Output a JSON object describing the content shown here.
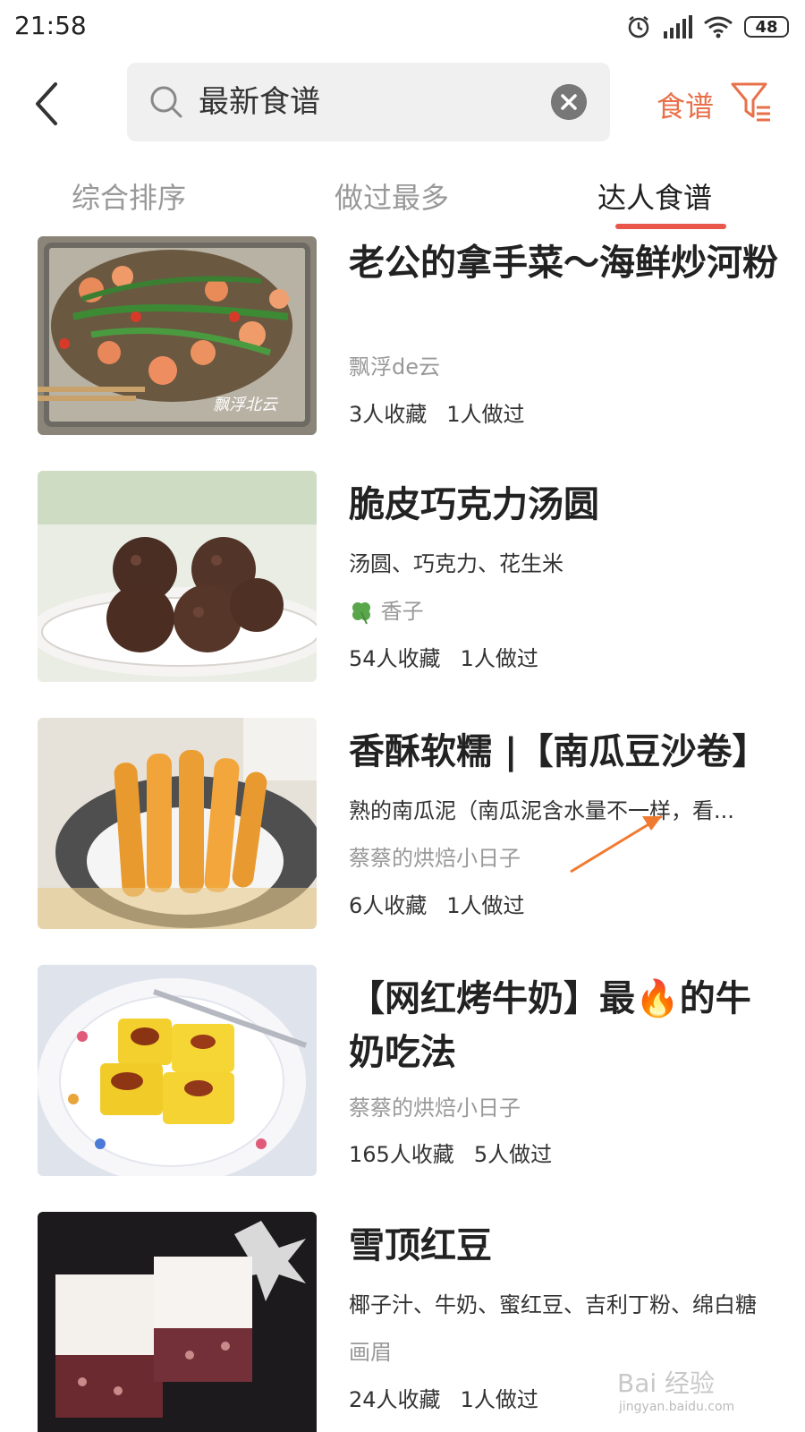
{
  "status_bar": {
    "time": "21:58",
    "battery": "48"
  },
  "search": {
    "query": "最新食谱"
  },
  "header": {
    "filter_label": "食谱"
  },
  "tabs": [
    {
      "label": "综合排序",
      "active": false
    },
    {
      "label": "做过最多",
      "active": false
    },
    {
      "label": "达人食谱",
      "active": true
    }
  ],
  "recipes": [
    {
      "title": "老公的拿手菜～海鲜炒河粉",
      "author": "飘浮de云",
      "saves": "3人收藏",
      "made": "1人做过",
      "image": "seafood-noodles-photo",
      "image_caption": "飘浮北云"
    },
    {
      "title": "脆皮巧克力汤圆",
      "ingredients": "汤圆、巧克力、花生米",
      "author": "香子",
      "saves": "54人收藏",
      "made": "1人做过",
      "image": "chocolate-tangyuan-photo"
    },
    {
      "title": "香酥软糯 |【南瓜豆沙卷】",
      "ingredients": "熟的南瓜泥（南瓜泥含水量不一样，看...",
      "author": "蔡蔡的烘焙小日子",
      "saves": "6人收藏",
      "made": "1人做过",
      "image": "pumpkin-rolls-photo"
    },
    {
      "title": "【网红烤牛奶】最🔥的牛奶吃法",
      "author": "蔡蔡的烘焙小日子",
      "saves": "165人收藏",
      "made": "5人做过",
      "image": "baked-milk-photo"
    },
    {
      "title": "雪顶红豆",
      "ingredients": "椰子汁、牛奶、蜜红豆、吉利丁粉、绵白糖",
      "author": "画眉",
      "saves": "24人收藏",
      "made": "1人做过",
      "image": "red-bean-jelly-photo"
    }
  ],
  "watermark": {
    "brand": "Bai 经验",
    "url": "jingyan.baidu.com"
  },
  "colors": {
    "accent": "#e8704a",
    "tab_underline": "#e8574a",
    "annotation_arrow": "#f07a30"
  }
}
